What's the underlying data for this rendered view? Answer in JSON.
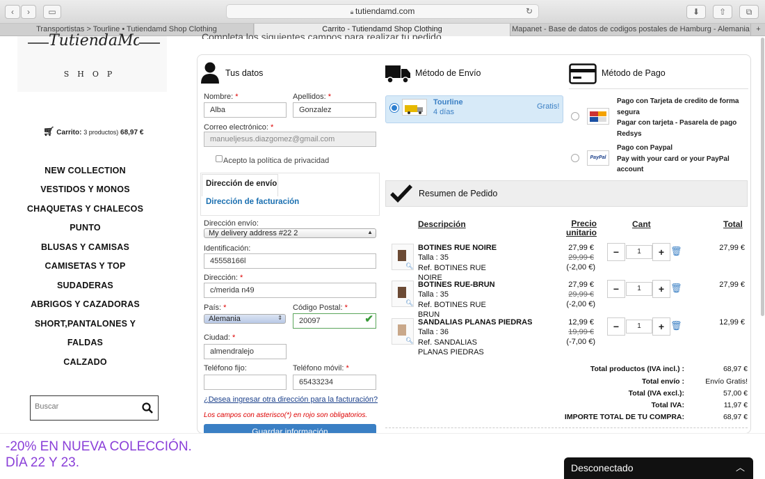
{
  "browser": {
    "url": "tutiendamd.com",
    "tabs": [
      "Transportistas > Tourline • Tutiendamd Shop Clothing",
      "Carrito - Tutiendamd Shop Clothing",
      "Mapanet - Base de datos de codigos postales de Hamburg - Alemania"
    ]
  },
  "top_cut_text": "Completa los siguientes campos para realizar tu pedido",
  "logo": {
    "name": "TutiendaMd",
    "sub": "SHOP"
  },
  "cart": {
    "label": "Carrito:",
    "count": "3 productos)",
    "total": "68,97 €"
  },
  "menu": [
    "NEW COLLECTION",
    "VESTIDOS Y MONOS",
    "CHAQUETAS Y CHALECOS",
    "PUNTO",
    "BLUSAS Y CAMISAS",
    "CAMISETAS Y TOP",
    "SUDADERAS",
    "ABRIGOS Y CAZADORAS",
    "SHORT,PANTALONES Y",
    "FALDAS",
    "CALZADO"
  ],
  "search": {
    "placeholder": "Buscar"
  },
  "tus_datos": {
    "title": "Tus datos",
    "nombre_label": "Nombre:",
    "nombre": "Alba",
    "apellidos_label": "Apellidos:",
    "apellidos": "Gonzalez",
    "email_label": "Correo electrónico:",
    "email": "manueljesus.diazgomez@gmail.com",
    "privacy": "Acepto la política de privacidad",
    "tab_envio": "Dirección de envío",
    "tab_fact": "Dirección de facturación",
    "dir_envio_label": "Dirección envío:",
    "dir_envio": "My delivery address #22 2",
    "ident_label": "Identificación:",
    "ident": "45558166l",
    "direccion_label": "Dirección:",
    "direccion": "c/merida n49",
    "pais_label": "País:",
    "pais": "Alemania",
    "cp_label": "Código Postal:",
    "cp": "20097",
    "ciudad_label": "Ciudad:",
    "ciudad": "almendralejo",
    "tel_label": "Teléfono fijo:",
    "tel": "",
    "movil_label": "Teléfono móvil:",
    "movil": "65433234",
    "other_addr": "¿Desea ingresar otra dirección para la facturación?",
    "required_note": "Los campos con asterisco(*) en rojo son obligatorios.",
    "save_btn": "Guardar información"
  },
  "envio": {
    "title": "Método de Envío",
    "carrier": "Tourline",
    "days": "4 días",
    "price": "Gratis!"
  },
  "pago": {
    "title": "Método de Pago",
    "opt1": "Pago con Tarjeta de credito de forma segura",
    "opt1b": "Pagar con tarjeta - Pasarela de pago Redsys",
    "opt2": "Pago con Paypal",
    "opt2b": "Pay with your card or your PayPal account"
  },
  "resumen": {
    "title": "Resumen de Pedido",
    "cols": {
      "desc": "Descripción",
      "precio": "Precio unitario",
      "cant": "Cant",
      "total": "Total"
    },
    "items": [
      {
        "name": "BOTINES RUE NOIRE",
        "talla": "Talla : 35",
        "ref": "Ref. BOTINES RUE NOIRE",
        "price": "27,99 €",
        "old": "29,99 €",
        "disc": "(-2,00 €)",
        "qty": "1",
        "total": "27,99 €"
      },
      {
        "name": "BOTINES RUE-BRUN",
        "talla": "Talla : 35",
        "ref": "Ref. BOTINES RUE BRUN",
        "price": "27,99 €",
        "old": "29,99 €",
        "disc": "(-2,00 €)",
        "qty": "1",
        "total": "27,99 €"
      },
      {
        "name": "SANDALIAS PLANAS PIEDRAS",
        "talla": "Talla : 36",
        "ref": "Ref. SANDALIAS PLANAS PIEDRAS",
        "price": "12,99 €",
        "old": "19,99 €",
        "disc": "(-7,00 €)",
        "qty": "1",
        "total": "12,99 €"
      }
    ],
    "totals": [
      [
        "Total productos  (IVA incl.) :",
        "68,97 €"
      ],
      [
        "Total envío :",
        "Envío Gratis!"
      ],
      [
        "Total  (IVA excl.):",
        "57,00 €"
      ],
      [
        "Total IVA:",
        "11,97 €"
      ],
      [
        "IMPORTE TOTAL DE TU COMPRA:",
        "68,97 €"
      ]
    ]
  },
  "promo": {
    "line1": "-20% EN NUEVA COLECCIÓN.",
    "line2": "DÍA 22 Y 23.",
    "color": "#8a3fd8"
  },
  "chat": {
    "label": "Desconectado"
  }
}
